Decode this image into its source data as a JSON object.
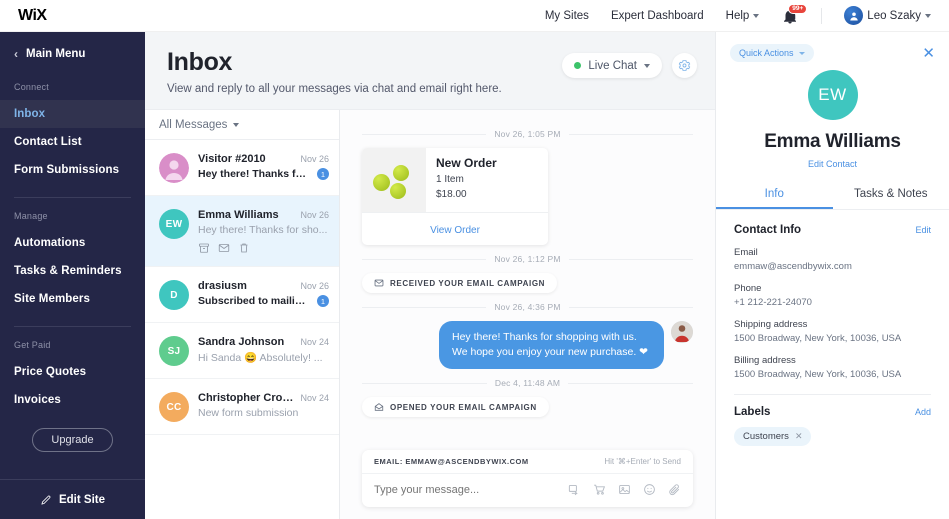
{
  "topbar": {
    "logo": "WiX",
    "links": [
      {
        "label": "My Sites"
      },
      {
        "label": "Expert Dashboard"
      },
      {
        "label": "Help"
      }
    ],
    "notifications_badge": "99+",
    "user_name": "Leo Szaky"
  },
  "sidebar": {
    "main_menu": "Main Menu",
    "groups": [
      {
        "title": "Connect",
        "items": [
          {
            "label": "Inbox",
            "active": true
          },
          {
            "label": "Contact List",
            "active": false
          },
          {
            "label": "Form Submissions",
            "active": false
          }
        ]
      },
      {
        "title": "Manage",
        "items": [
          {
            "label": "Automations",
            "active": false
          },
          {
            "label": "Tasks & Reminders",
            "active": false
          },
          {
            "label": "Site Members",
            "active": false
          }
        ]
      },
      {
        "title": "Get Paid",
        "items": [
          {
            "label": "Price Quotes",
            "active": false
          },
          {
            "label": "Invoices",
            "active": false
          }
        ]
      }
    ],
    "upgrade_label": "Upgrade",
    "edit_site_label": "Edit Site"
  },
  "inbox": {
    "title": "Inbox",
    "subtitle": "View and reply to all your messages via chat and email right here.",
    "live_chat_label": "Live Chat",
    "live_chat_status_color": "#3cc36a",
    "filter_label": "All Messages"
  },
  "conversations": [
    {
      "name": "Visitor #2010",
      "date": "Nov 26",
      "preview": "Hey there! Thanks for ...",
      "unread_count": "1",
      "avatar_text": "",
      "avatar_color": "#d98ec8",
      "avatar_type": "ghost",
      "selected": false,
      "preview_muted": false
    },
    {
      "name": "Emma Williams",
      "date": "Nov 26",
      "preview": "Hey there! Thanks for sho...",
      "unread_count": "",
      "avatar_text": "EW",
      "avatar_color": "#3fc6bf",
      "avatar_type": "initials",
      "selected": true,
      "preview_muted": true,
      "actions": [
        "archive-icon",
        "mail-icon",
        "trash-icon"
      ]
    },
    {
      "name": "drasiusm",
      "date": "Nov 26",
      "preview": "Subscribed to mailing ...",
      "unread_count": "1",
      "avatar_text": "D",
      "avatar_color": "#3fc6bf",
      "avatar_type": "initials",
      "selected": false,
      "preview_muted": false
    },
    {
      "name": "Sandra Johnson",
      "date": "Nov 24",
      "preview": "Hi Sanda 😄  Absolutely! ...",
      "unread_count": "",
      "avatar_text": "SJ",
      "avatar_color": "#5fcc8e",
      "avatar_type": "initials",
      "selected": false,
      "preview_muted": true
    },
    {
      "name": "Christopher Cropper",
      "date": "Nov 24",
      "preview": "New form submission",
      "unread_count": "",
      "avatar_text": "CC",
      "avatar_color": "#f3ab5e",
      "avatar_type": "initials",
      "selected": false,
      "preview_muted": true
    }
  ],
  "chat": {
    "timestamps": {
      "t1": "Nov 26, 1:05 PM",
      "t2": "Nov 26, 1:12 PM",
      "t3": "Nov 26, 4:36 PM",
      "t4": "Dec 4, 11:48 AM"
    },
    "order_card": {
      "title": "New Order",
      "items": "1 Item",
      "price": "$18.00",
      "link": "View Order"
    },
    "event_received": "RECEIVED YOUR EMAIL CAMPAIGN",
    "event_opened": "OPENED YOUR EMAIL CAMPAIGN",
    "outgoing_message": "Hey there! Thanks for shopping with us. We hope you enjoy your new purchase. ❤"
  },
  "composer": {
    "email_line": "EMAIL: EMMAW@ASCENDBYWIX.COM",
    "send_hint": "Hit '⌘+Enter' to Send",
    "placeholder": "Type your message..."
  },
  "contact_panel": {
    "quick_actions": "Quick Actions",
    "avatar_initials": "EW",
    "avatar_color": "#3fc6bf",
    "name": "Emma Williams",
    "edit_contact": "Edit Contact",
    "tabs": [
      {
        "label": "Info",
        "active": true
      },
      {
        "label": "Tasks & Notes",
        "active": false
      }
    ],
    "contact_info": {
      "title": "Contact Info",
      "edit": "Edit",
      "fields": [
        {
          "label": "Email",
          "value": "emmaw@ascendbywix.com"
        },
        {
          "label": "Phone",
          "value": "+1 212-221-24070"
        },
        {
          "label": "Shipping address",
          "value": "1500 Broadway, New York, 10036, USA"
        },
        {
          "label": "Billing address",
          "value": "1500 Broadway, New York, 10036, USA"
        }
      ]
    },
    "labels": {
      "title": "Labels",
      "add": "Add",
      "chips": [
        {
          "text": "Customers"
        }
      ]
    }
  }
}
